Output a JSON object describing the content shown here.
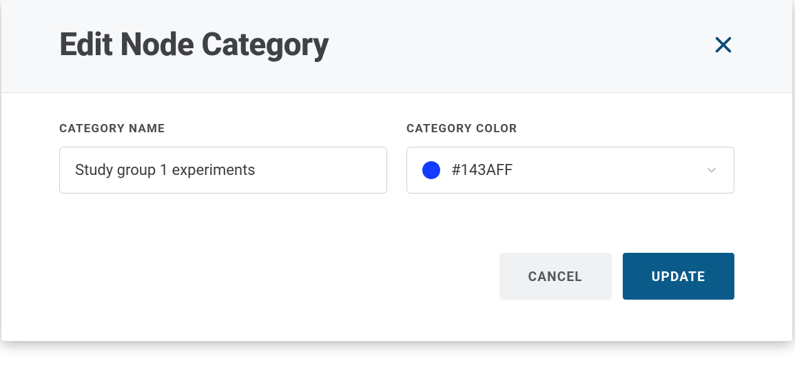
{
  "modal": {
    "title": "Edit Node Category",
    "fields": {
      "category_name": {
        "label": "CATEGORY NAME",
        "value": "Study group 1 experiments"
      },
      "category_color": {
        "label": "CATEGORY COLOR",
        "value": "#143AFF",
        "swatch_hex": "#143AFF"
      }
    },
    "buttons": {
      "cancel": "CANCEL",
      "update": "UPDATE"
    },
    "colors": {
      "close_icon": "#0b4a75",
      "primary_button_bg": "#0b5b8a"
    }
  }
}
